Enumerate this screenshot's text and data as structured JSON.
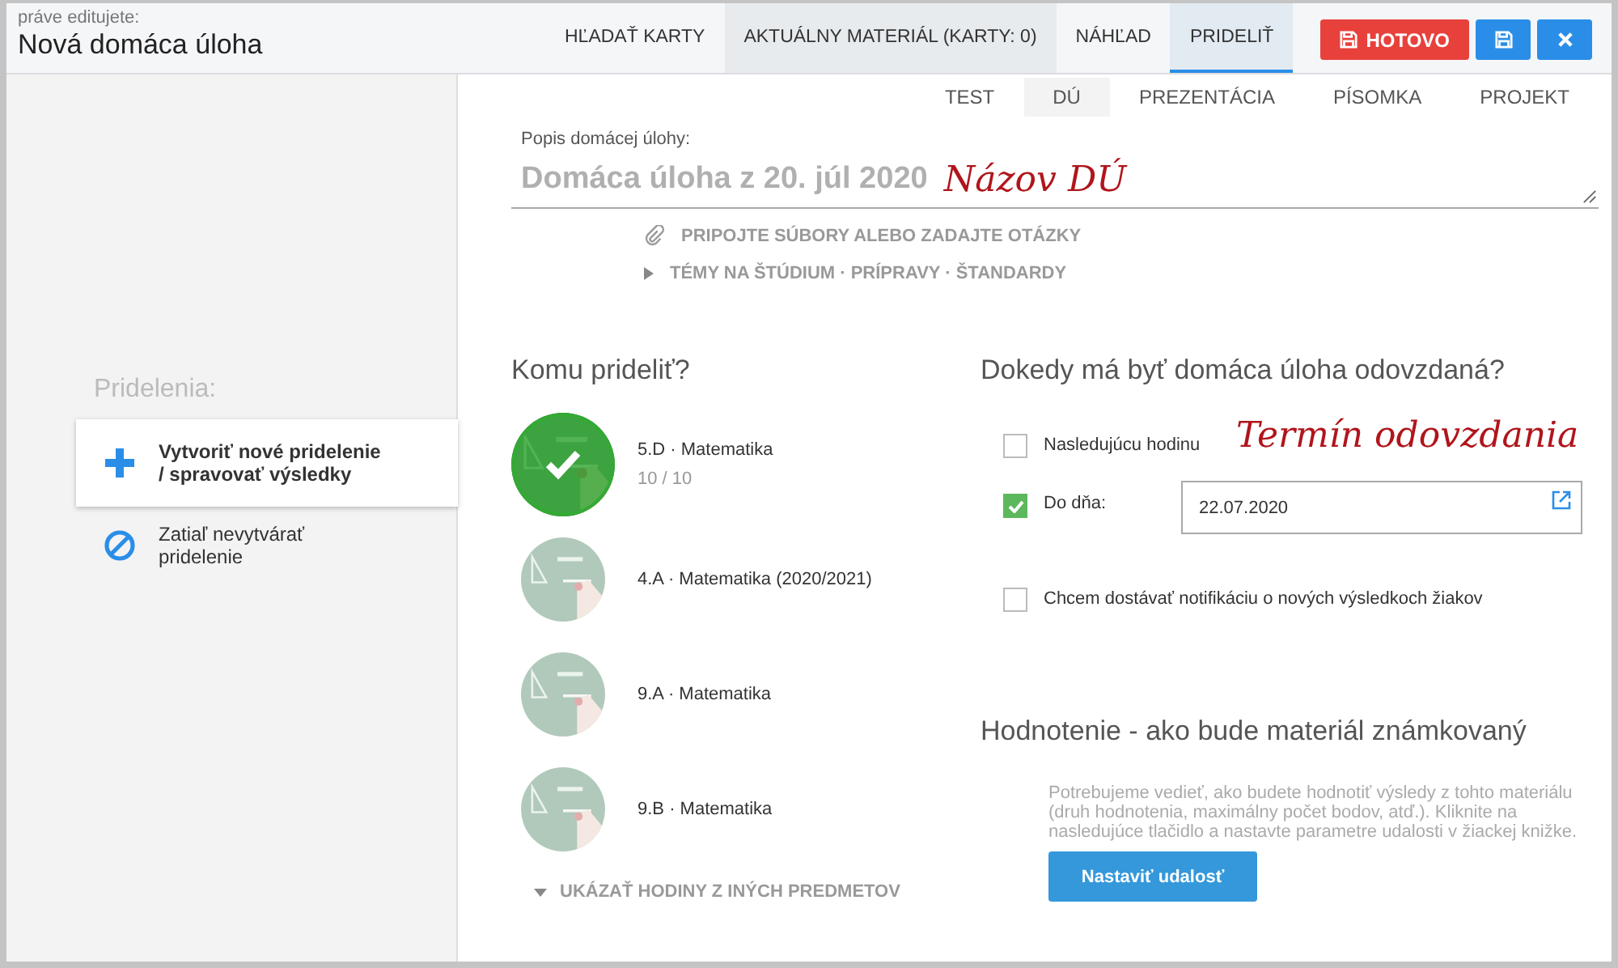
{
  "header": {
    "caption": "práve editujete:",
    "title": "Nová domáca úloha"
  },
  "nav_tabs": [
    {
      "label": "HĽADAŤ KARTY",
      "selected": false
    },
    {
      "label": "AKTUÁLNY MATERIÁL (KARTY: 0)",
      "selected": false
    },
    {
      "label": "NÁHĽAD",
      "selected": false
    },
    {
      "label": "PRIDELIŤ",
      "selected": true
    }
  ],
  "actions": [
    {
      "kind": "done",
      "label": "HOTOVO"
    },
    {
      "kind": "save"
    },
    {
      "kind": "close"
    }
  ],
  "type_tabs": [
    {
      "label": "TEST",
      "selected": false
    },
    {
      "label": "DÚ",
      "selected": true
    },
    {
      "label": "PREZENTÁCIA",
      "selected": false
    },
    {
      "label": "PÍSOMKA",
      "selected": false
    },
    {
      "label": "PROJEKT",
      "selected": false
    }
  ],
  "description": {
    "label": "Popis domácej úlohy:",
    "placeholder": "Domáca úloha z 20. júl 2020",
    "annotation": "Názov DÚ"
  },
  "links": [
    {
      "kind": "attach",
      "label": "PRIPOJTE SÚBORY ALEBO ZADAJTE OTÁZKY"
    },
    {
      "kind": "expand",
      "label": "TÉMY NA ŠTÚDIUM · PRÍPRAVY · ŠTANDARDY"
    }
  ],
  "sidebar": {
    "title": "Pridelenia:",
    "items": [
      {
        "kind": "create",
        "label": "Vytvoriť nové pridelenie / spravovať výsledky",
        "selected": true
      },
      {
        "kind": "none",
        "label": "Zatiaľ nevytvárať pridelenie",
        "selected": false
      }
    ]
  },
  "assign": {
    "title": "Komu prideliť?",
    "classes": [
      {
        "label": "5.D · Matematika",
        "count": "10 / 10",
        "selected": true
      },
      {
        "label": "4.A · Matematika (2020/2021)",
        "selected": false
      },
      {
        "label": "9.A · Matematika",
        "selected": false
      },
      {
        "label": "9.B · Matematika",
        "selected": false
      }
    ],
    "more": "UKÁZAŤ HODINY Z INÝCH PREDMETOV"
  },
  "deadline": {
    "title": "Dokedy má byť domáca úloha odovzdaná?",
    "annotation": "Termín odovzdania",
    "options": [
      {
        "kind": "checkbox",
        "label": "Nasledujúcu hodinu",
        "checked": false
      },
      {
        "kind": "date",
        "label": "Do dňa:",
        "checked": true,
        "value": "22.07.2020"
      },
      {
        "kind": "checkbox",
        "label": "Chcem dostávať notifikáciu o nových výsledkoch žiakov",
        "checked": false
      }
    ]
  },
  "grading": {
    "title": "Hodnotenie - ako bude materiál známkovaný",
    "text": "Potrebujeme vedieť, ako budete hodnotiť výsledy z tohto materiálu (druh hodnotenia, maximálny počet bodov, atď.). Kliknite na nasledujúce tlačidlo a nastavte parametre udalosti v žiackej knižke.",
    "button": "Nastaviť udalosť"
  }
}
